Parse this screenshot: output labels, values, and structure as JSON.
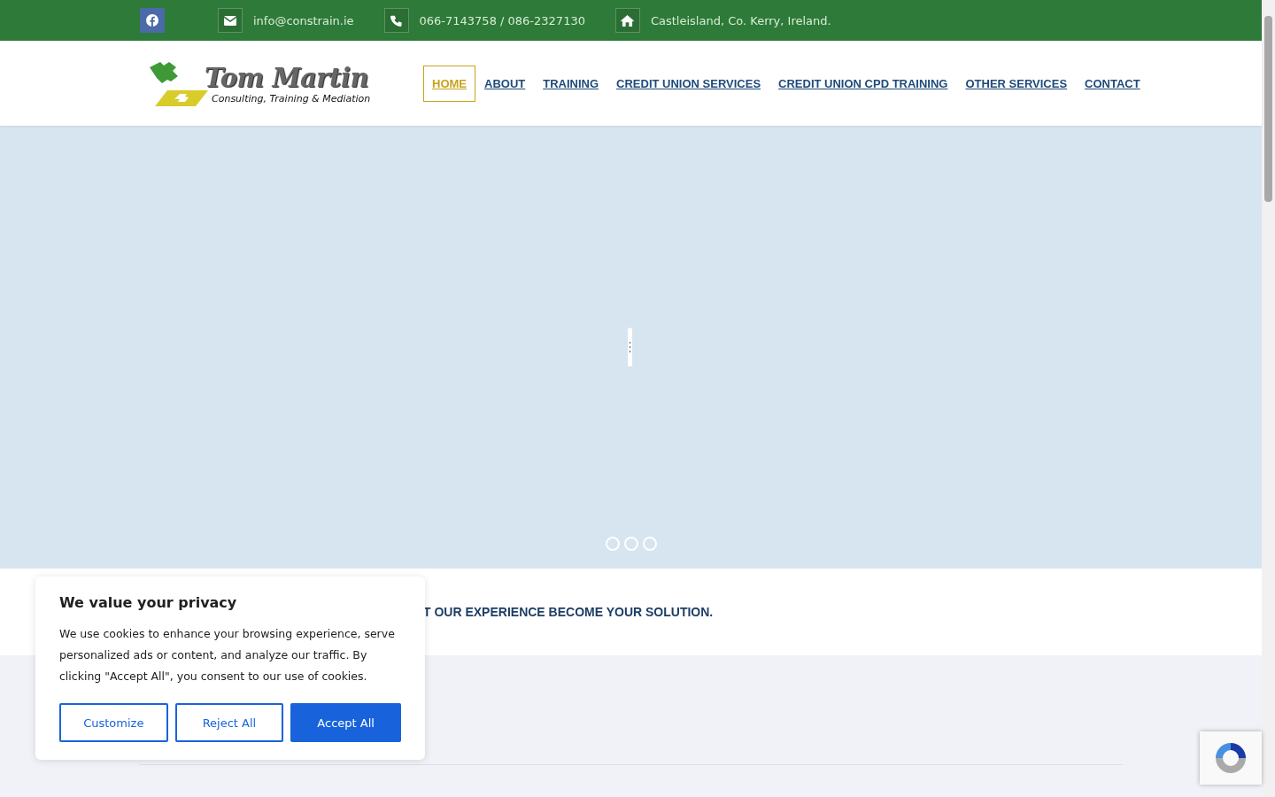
{
  "topbar": {
    "email": "info@constrain.ie",
    "phone": "066-7143758 / 086-2327130",
    "address": "Castleisland, Co. Kerry, Ireland."
  },
  "logo": {
    "title": "Tom Martin",
    "subtitle": "Consulting, Training & Mediation"
  },
  "nav": [
    {
      "label": "HOME",
      "selected": true
    },
    {
      "label": "ABOUT",
      "selected": false
    },
    {
      "label": "TRAINING",
      "selected": false
    },
    {
      "label": "CREDIT UNION SERVICES",
      "selected": false
    },
    {
      "label": "CREDIT UNION CPD TRAINING",
      "selected": false
    },
    {
      "label": "OTHER SERVICES",
      "selected": false
    },
    {
      "label": "CONTACT",
      "selected": false
    }
  ],
  "slider": {
    "dots": [
      {
        "selected": false
      },
      {
        "selected": false
      },
      {
        "selected": false
      }
    ]
  },
  "tagline": "T OUR EXPERIENCE BECOME YOUR SOLUTION.",
  "cookie_banner": {
    "title": "We value your privacy",
    "text": "We use cookies to enhance your browsing experience, serve personalized ads or content, and analyze our traffic. By clicking \"Accept All\", you consent to our use of cookies.",
    "buttons": [
      {
        "label": "Customize",
        "kind": "outline"
      },
      {
        "label": "Reject All",
        "kind": "outline"
      },
      {
        "label": "Accept All",
        "kind": "primary"
      }
    ]
  }
}
